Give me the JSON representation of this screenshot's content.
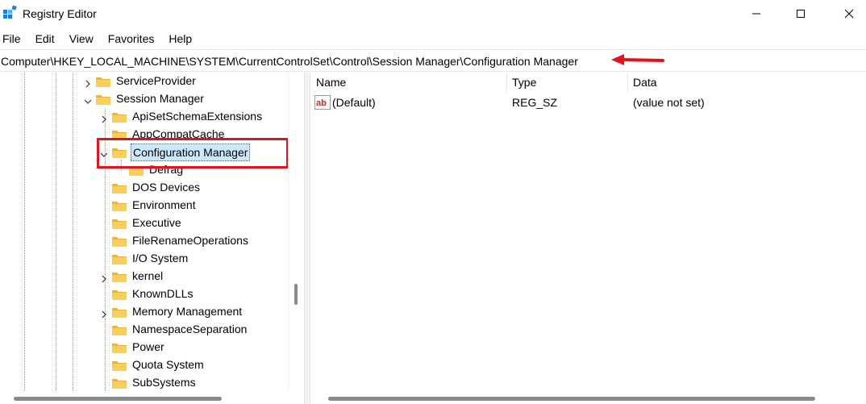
{
  "window": {
    "title": "Registry Editor",
    "controls": {
      "minimize": "minimize",
      "maximize": "maximize",
      "close": "close"
    }
  },
  "menu": [
    "File",
    "Edit",
    "View",
    "Favorites",
    "Help"
  ],
  "address": "Computer\\HKEY_LOCAL_MACHINE\\SYSTEM\\CurrentControlSet\\Control\\Session Manager\\Configuration Manager",
  "tree": [
    {
      "label": "ServiceProvider",
      "expander": "collapsed"
    },
    {
      "label": "Session Manager",
      "expander": "expanded"
    },
    {
      "label": "ApiSetSchemaExtensions",
      "expander": "collapsed"
    },
    {
      "label": "AppCompatCache",
      "expander": "none"
    },
    {
      "label": "Configuration Manager",
      "expander": "expanded",
      "selected": true
    },
    {
      "label": "Defrag",
      "expander": "none"
    },
    {
      "label": "DOS Devices",
      "expander": "none"
    },
    {
      "label": "Environment",
      "expander": "none"
    },
    {
      "label": "Executive",
      "expander": "none"
    },
    {
      "label": "FileRenameOperations",
      "expander": "none"
    },
    {
      "label": "I/O System",
      "expander": "none"
    },
    {
      "label": "kernel",
      "expander": "collapsed"
    },
    {
      "label": "KnownDLLs",
      "expander": "none"
    },
    {
      "label": "Memory Management",
      "expander": "collapsed"
    },
    {
      "label": "NamespaceSeparation",
      "expander": "none"
    },
    {
      "label": "Power",
      "expander": "none"
    },
    {
      "label": "Quota System",
      "expander": "none"
    },
    {
      "label": "SubSystems",
      "expander": "none"
    }
  ],
  "columns": {
    "name": "Name",
    "type": "Type",
    "data": "Data"
  },
  "values": [
    {
      "icon": "string-value-icon",
      "name": "(Default)",
      "type": "REG_SZ",
      "data": "(value not set)"
    }
  ],
  "colors": {
    "highlight_box": "#e0141c",
    "selection": "#cce8ff",
    "folder": "#f4c542"
  }
}
